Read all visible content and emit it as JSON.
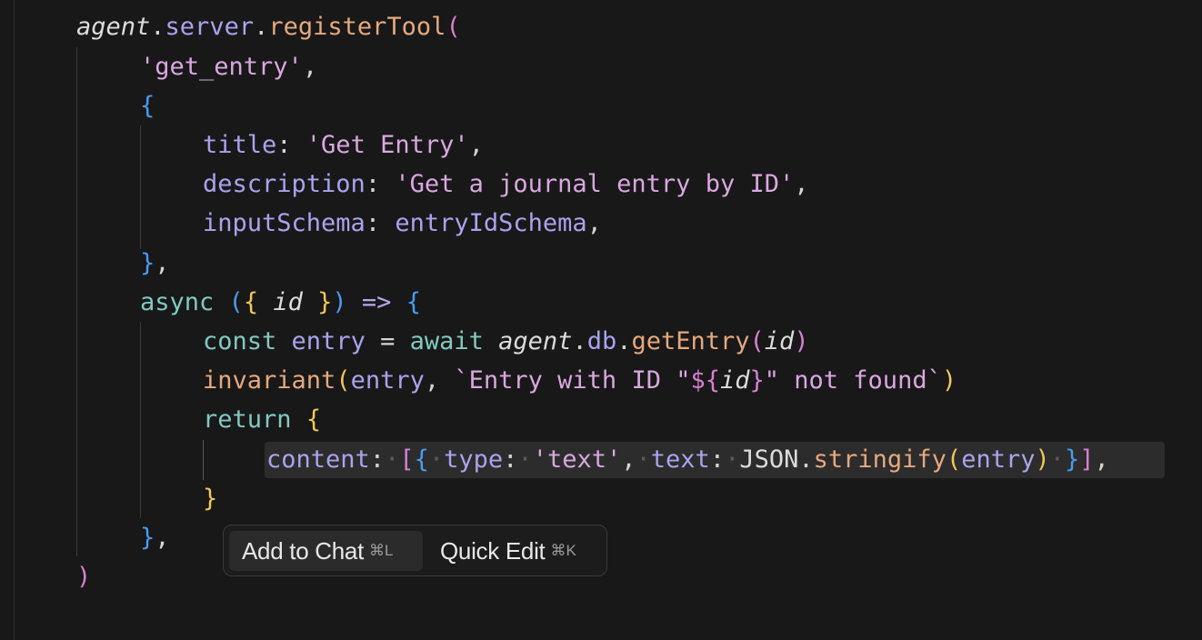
{
  "code": {
    "lines": [
      [
        [
          "agent",
          "var italic"
        ],
        [
          ".",
          "punct"
        ],
        [
          "server",
          "prop"
        ],
        [
          ".",
          "punct"
        ],
        [
          "registerTool",
          "fn"
        ],
        [
          "(",
          "b2"
        ]
      ],
      [
        [
          "'get_entry'",
          "str"
        ],
        [
          ",",
          "punct"
        ]
      ],
      [
        [
          "{",
          "b3"
        ]
      ],
      [
        [
          "title",
          "prop"
        ],
        [
          ": ",
          "punct"
        ],
        [
          "'Get Entry'",
          "str"
        ],
        [
          ",",
          "punct"
        ]
      ],
      [
        [
          "description",
          "prop"
        ],
        [
          ": ",
          "punct"
        ],
        [
          "'Get a journal entry by ID'",
          "str"
        ],
        [
          ",",
          "punct"
        ]
      ],
      [
        [
          "inputSchema",
          "prop"
        ],
        [
          ": ",
          "punct"
        ],
        [
          "entryIdSchema",
          "prop"
        ],
        [
          ",",
          "punct"
        ]
      ],
      [
        [
          "}",
          "b3"
        ],
        [
          ",",
          "punct"
        ]
      ],
      [
        [
          "async",
          "kw"
        ],
        [
          " ",
          "punct"
        ],
        [
          "(",
          "b3"
        ],
        [
          "{",
          "b1"
        ],
        [
          " ",
          "punct"
        ],
        [
          "id",
          "var italic"
        ],
        [
          " ",
          "punct"
        ],
        [
          "}",
          "b1"
        ],
        [
          ")",
          "b3"
        ],
        [
          " ",
          "punct"
        ],
        [
          "=>",
          "kw2"
        ],
        [
          " ",
          "punct"
        ],
        [
          "{",
          "b3"
        ]
      ],
      [
        [
          "const",
          "kw"
        ],
        [
          " ",
          "punct"
        ],
        [
          "entry",
          "prop"
        ],
        [
          " = ",
          "punct"
        ],
        [
          "await",
          "kw"
        ],
        [
          " ",
          "punct"
        ],
        [
          "agent",
          "var italic"
        ],
        [
          ".",
          "punct"
        ],
        [
          "db",
          "prop"
        ],
        [
          ".",
          "punct"
        ],
        [
          "getEntry",
          "fn"
        ],
        [
          "(",
          "b2"
        ],
        [
          "id",
          "var italic"
        ],
        [
          ")",
          "b2"
        ]
      ],
      [
        [
          "invariant",
          "fn"
        ],
        [
          "(",
          "b1"
        ],
        [
          "entry",
          "prop"
        ],
        [
          ", ",
          "punct"
        ],
        [
          "`Entry with ID \"",
          "str"
        ],
        [
          "${",
          "b2"
        ],
        [
          "id",
          "var italic"
        ],
        [
          "}",
          "b2"
        ],
        [
          "\" not found`",
          "str"
        ],
        [
          ")",
          "b1"
        ]
      ],
      [
        [
          "return",
          "kw"
        ],
        [
          " ",
          "punct"
        ],
        [
          "{",
          "b1"
        ]
      ],
      [
        [
          "content",
          "prop"
        ],
        [
          ":",
          "punct"
        ],
        [
          "·",
          "ws"
        ],
        [
          "[",
          "b2"
        ],
        [
          "{",
          "b3"
        ],
        [
          "·",
          "ws"
        ],
        [
          "type",
          "prop"
        ],
        [
          ":",
          "punct"
        ],
        [
          "·",
          "ws"
        ],
        [
          "'text'",
          "str"
        ],
        [
          ",",
          "punct"
        ],
        [
          "·",
          "ws"
        ],
        [
          "text",
          "prop"
        ],
        [
          ":",
          "punct"
        ],
        [
          "·",
          "ws"
        ],
        [
          "JSON",
          "var"
        ],
        [
          ".",
          "punct"
        ],
        [
          "stringify",
          "fn"
        ],
        [
          "(",
          "b1"
        ],
        [
          "entry",
          "prop"
        ],
        [
          ")",
          "b1"
        ],
        [
          "·",
          "ws"
        ],
        [
          "}",
          "b3"
        ],
        [
          "]",
          "b2"
        ],
        [
          ",",
          "punct"
        ]
      ],
      [
        [
          "}",
          "b1"
        ]
      ],
      [
        [
          "}",
          "b3"
        ],
        [
          ",",
          "punct"
        ]
      ],
      [
        [
          ")",
          "b2"
        ]
      ]
    ]
  },
  "toolbar": {
    "add_to_chat_label": "Add to Chat",
    "add_to_chat_shortcut": "⌘L",
    "quick_edit_label": "Quick Edit",
    "quick_edit_shortcut": "⌘K"
  },
  "theme": {
    "background": "#181818",
    "selection": "#2c2c2c",
    "string": "#d9a7e0",
    "property": "#a9a3ee",
    "function": "#e5a97d",
    "keyword": "#82c9c1"
  }
}
